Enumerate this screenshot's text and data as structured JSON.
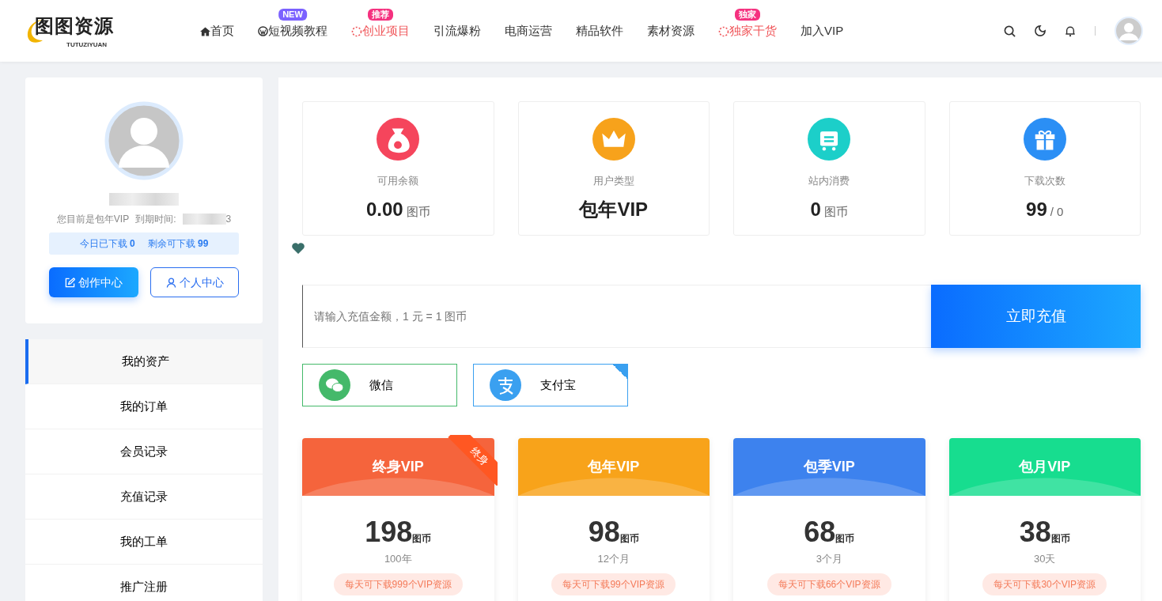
{
  "logo": {
    "text": "图图资源",
    "subtext": "TUTUZIYUAN"
  },
  "nav": [
    {
      "label": "首页",
      "kind": "home",
      "highlight": false
    },
    {
      "label": "短视频教程",
      "kind": "wordpress",
      "highlight": false,
      "badge": {
        "text": "NEW",
        "color": "#7b61ff"
      }
    },
    {
      "label": "创业项目",
      "kind": "spinner",
      "highlight": true,
      "badge": {
        "text": "推荐",
        "color": "#f5317f"
      }
    },
    {
      "label": "引流爆粉",
      "kind": "plain",
      "highlight": false
    },
    {
      "label": "电商运营",
      "kind": "plain",
      "highlight": false
    },
    {
      "label": "精品软件",
      "kind": "plain",
      "highlight": false
    },
    {
      "label": "素材资源",
      "kind": "plain",
      "highlight": false
    },
    {
      "label": "独家干货",
      "kind": "spinner",
      "highlight": true,
      "badge": {
        "text": "独家",
        "color": "#f5317f"
      }
    },
    {
      "label": "加入VIP",
      "kind": "plain",
      "highlight": false
    }
  ],
  "profile": {
    "vip_text": "您目前是包年VIP",
    "expiry_label": "到期时间:",
    "expiry_tail": "3",
    "downloads_today": "今日已下载 **0**",
    "downloads_left": "剩余可下载 **99**",
    "buttons": [
      {
        "label": "创作中心",
        "kind": "primary"
      },
      {
        "label": "个人中心",
        "kind": "outline"
      }
    ]
  },
  "menu": [
    {
      "label": "我的资产",
      "selected": true
    },
    {
      "label": "我的订单",
      "selected": false
    },
    {
      "label": "会员记录",
      "selected": false
    },
    {
      "label": "充值记录",
      "selected": false
    },
    {
      "label": "我的工单",
      "selected": false
    },
    {
      "label": "推广注册",
      "selected": false
    }
  ],
  "stats": [
    {
      "label": "可用余额",
      "value": "0.00",
      "unit": "图币",
      "kind": "moneybag",
      "color": "#f5455c"
    },
    {
      "label": "用户类型",
      "value": "包年VIP",
      "kind": "crown",
      "color": "#f7a21b"
    },
    {
      "label": "站内消费",
      "value": "0",
      "unit": "图币",
      "kind": "cart",
      "color": "#1ccfc9"
    },
    {
      "label": "下载次数",
      "value": "99",
      "unit": "/ 0",
      "kind": "gift",
      "color": "#2b8ff5"
    }
  ],
  "recharge": {
    "placeholder": "请输入充值金额，1 元 = 1 图币",
    "button": "立即充值"
  },
  "payments": [
    {
      "label": "微信",
      "kind": "wechat",
      "selected": false
    },
    {
      "label": "支付宝",
      "kind": "alipay",
      "selected": true
    }
  ],
  "plans": [
    {
      "name": "终身VIP",
      "price": "198",
      "unit": "图币",
      "period": "100年",
      "perk": "每天可下载999个VIP资源",
      "ribbon": "终身",
      "color": "#f5643c"
    },
    {
      "name": "包年VIP",
      "price": "98",
      "unit": "图币",
      "period": "12个月",
      "perk": "每天可下载99个VIP资源",
      "color": "#f8a31a"
    },
    {
      "name": "包季VIP",
      "price": "68",
      "unit": "图币",
      "period": "3个月",
      "perk": "每天可下载66个VIP资源",
      "color": "#3d82ee"
    },
    {
      "name": "包月VIP",
      "price": "38",
      "unit": "图币",
      "period": "30天",
      "perk": "每天可下载30个VIP资源",
      "color": "#17dd8f"
    }
  ]
}
